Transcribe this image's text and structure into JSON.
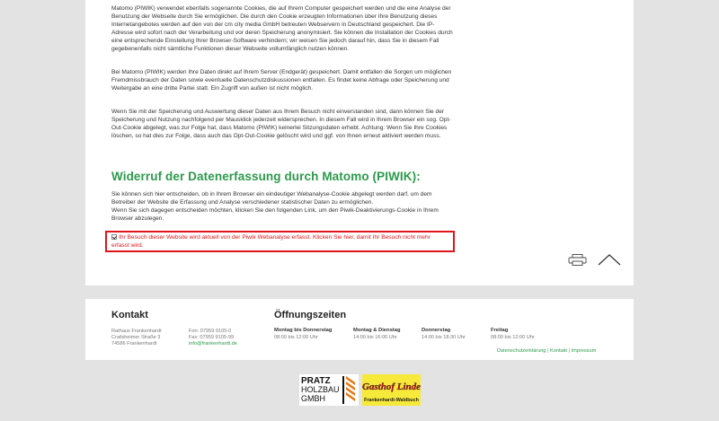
{
  "content": {
    "paragraph1": "Matomo (PIWIK) verwendet ebenfalls sogenannte Cookies, die auf Ihrem Computer gespeichert werden und die eine Analyse der Benutzung der Webseite durch Sie ermöglichen. Die durch den Cookie erzeugten Informationen über Ihre Benutzung dieses Internetangebotes werden auf den von der cm city media GmbH betreuten Webservern in Deutschland gespeichert. Die IP-Adresse wird sofort nach der Verarbeitung und vor deren Speicherung anonymisiert. Sie können die Installation der Cookies durch eine entsprechende Einstellung Ihrer Browser-Software verhindern; wir weisen Sie jedoch darauf hin, dass Sie in diesem Fall gegebenenfalls nicht sämtliche Funktionen dieser Webseite vollumfänglich nutzen können.",
    "paragraph2": "Bei Matomo (PIWIK) werden Ihre Daten direkt auf Ihrem Server (Endgerät) gespeichert. Damit entfallen die Sorgen um möglichen Fremdmissbrauch der Daten sowie eventuelle Datenschutzdiskussionen entfallen. Es findet keine Abfrage oder Speicherung und Weitergabe an eine dritte Partei statt. Ein Zugriff von außen ist nicht möglich.",
    "paragraph3": "Wenn Sie mit der Speicherung und Auswertung dieser Daten aus Ihrem Besuch nicht einverstanden sind, dann können Sie der Speicherung und Nutzung nachfolgend per Mausklick jederzeit widersprechen. In diesem Fall wird in Ihrem Browser ein sog. Opt-Out-Cookie abgelegt, was zur Folge hat, dass Matomo (PIWIK) keinerlei Sitzungsdaten erhebt. Achtung: Wenn Sie Ihre Cookies löschen, so hat dies zur Folge, dass auch das Opt-Out-Cookie gelöscht wird und ggf. von Ihnen erneut aktiviert werden muss.",
    "heading": "Widerruf der Datenerfassung durch Matomo (PIWIK):",
    "paragraph4": "Sie können sich hier entscheiden, ob in Ihrem Browser ein eindeutiger Webanalyse-Cookie abgelegt werden darf, um dem Betreiber der Website die Erfassung und Analyse verschiedener statistischer Daten zu ermöglichen.",
    "paragraph4b": "Wenn Sie sich dagegen entscheiden möchten, klicken Sie den folgenden Link, um den Piwik-Deaktivierungs-Cookie in Ihrem Browser abzulegen.",
    "optout_text": "Ihr Besuch dieser Website wird aktuell von der Piwik Webanalyse erfasst. Klicken Sie hier, damit Ihr Besuch nicht mehr erfasst wird."
  },
  "footer": {
    "kontakt_title": "Kontakt",
    "address": [
      "Rathaus Frankenhardt",
      "Crailsheimer Straße 3",
      "74586 Frankenhardt"
    ],
    "phone": "Fon: 07959 9105-0",
    "fax": "Fax: 07959 9105-99",
    "email": "info@frankenhardt.de",
    "hours_title": "Öffnungszeiten",
    "hours": [
      {
        "day": "Montag bis Donnerstag",
        "time": "08:00 bis 12:00 Uhr"
      },
      {
        "day": "Montag & Dienstag",
        "time": "14:00 bis 16:00 Uhr"
      },
      {
        "day": "Donnerstag",
        "time": "14:00 bis 18:30 Uhr"
      },
      {
        "day": "Freitag",
        "time": "08:00 bis 12:00 Uhr"
      }
    ],
    "links": [
      "Datenschutzerklärung",
      "Kontakt",
      "Impressum"
    ],
    "separator": "|"
  },
  "logos": {
    "logo1_line1": "PRATZ",
    "logo1_line2": "HOLZBAU",
    "logo1_line3": "GMBH",
    "logo2_line1": "Gasthof Linde",
    "logo2_line2": "Frankenhardt-Waldbuch"
  },
  "colors": {
    "accent_green": "#2c9a4b",
    "optout_red": "#e0151b",
    "background": "#e3e3e3"
  },
  "icons": [
    "print-icon",
    "back-to-top-icon",
    "checkbox-icon"
  ]
}
